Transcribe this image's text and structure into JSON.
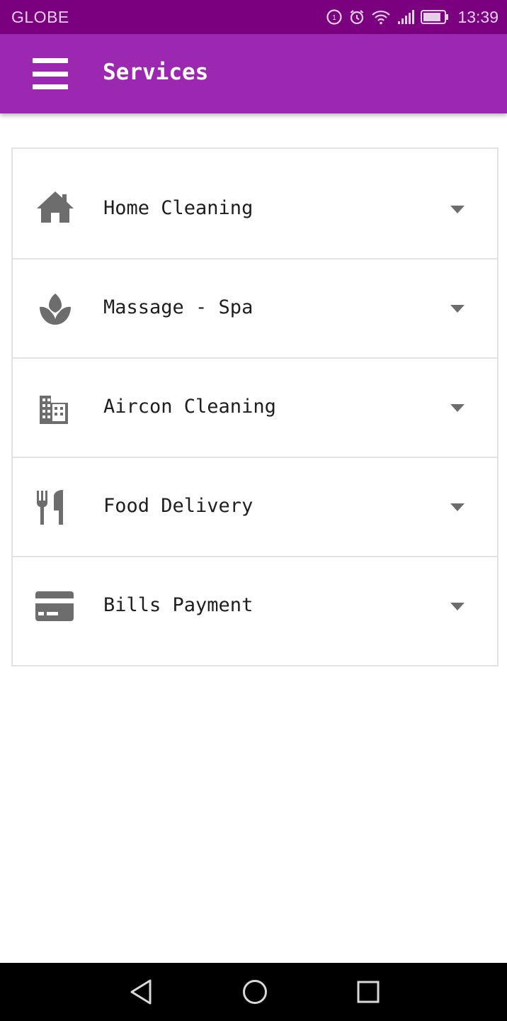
{
  "status_bar": {
    "carrier": "GLOBE",
    "time": "13:39",
    "icons": [
      "data-saver-icon",
      "alarm-icon",
      "wifi-icon",
      "signal-icon",
      "battery-icon"
    ]
  },
  "app_bar": {
    "title": "Services",
    "menu_icon": "hamburger-menu-icon",
    "color": "#9c27b0",
    "status_color": "#7b007f"
  },
  "services": [
    {
      "label": "Home Cleaning",
      "icon": "home-icon"
    },
    {
      "label": "Massage - Spa",
      "icon": "spa-icon"
    },
    {
      "label": "Aircon Cleaning",
      "icon": "building-icon"
    },
    {
      "label": "Food Delivery",
      "icon": "restaurant-icon"
    },
    {
      "label": "Bills Payment",
      "icon": "credit-card-icon"
    }
  ],
  "colors": {
    "icon_gray": "#6d6d6d",
    "divider": "#e2e2e2",
    "text": "#1e1e1e"
  },
  "nav_bar": {
    "buttons": [
      "back-icon",
      "home-circle-icon",
      "recents-icon"
    ]
  }
}
